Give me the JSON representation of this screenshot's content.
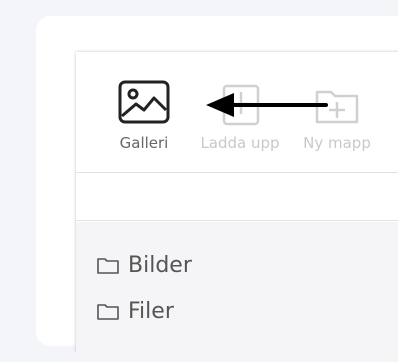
{
  "toolbar": {
    "galleri_label": "Galleri",
    "ladda_upp_label": "Ladda upp",
    "ny_mapp_label": "Ny mapp"
  },
  "file_list": {
    "items": [
      {
        "label": "Bilder",
        "icon": "folder-icon"
      },
      {
        "label": "Filer",
        "icon": "folder-icon"
      }
    ]
  },
  "colors": {
    "background": "#f4f5f9",
    "panel": "#ffffff",
    "list_background": "#f5f5f7",
    "disabled": "#c9c9c9",
    "arrow": "#000000"
  }
}
